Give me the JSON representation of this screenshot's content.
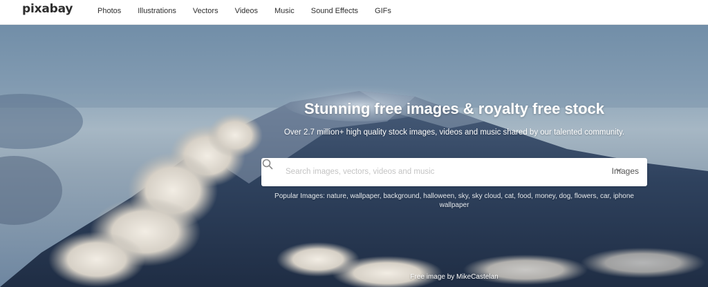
{
  "brand": {
    "logo_text": "pixabay"
  },
  "nav": {
    "items": [
      {
        "label": "Photos"
      },
      {
        "label": "Illustrations"
      },
      {
        "label": "Vectors"
      },
      {
        "label": "Videos"
      },
      {
        "label": "Music"
      },
      {
        "label": "Sound Effects"
      },
      {
        "label": "GIFs"
      }
    ]
  },
  "hero": {
    "headline": "Stunning free images & royalty free stock",
    "subline": "Over 2.7 million+ high quality stock images, videos and music shared by our talented community.",
    "search": {
      "placeholder": "Search images, vectors, videos and music",
      "value": "",
      "type_selected": "Images",
      "icon": "search-icon",
      "chevron_icon": "chevron-down-icon"
    },
    "popular": {
      "label": "Popular Images:",
      "tags_text": "nature, wallpaper, background, halloween, sky, sky cloud, cat, food, money, dog, flowers, car, iphone wallpaper"
    },
    "credit": "Free image by MikeCastelan"
  },
  "colors": {
    "nav_text": "#2e2e2e",
    "hero_text": "#ffffff",
    "mountain_dark": "#2a3c57"
  }
}
